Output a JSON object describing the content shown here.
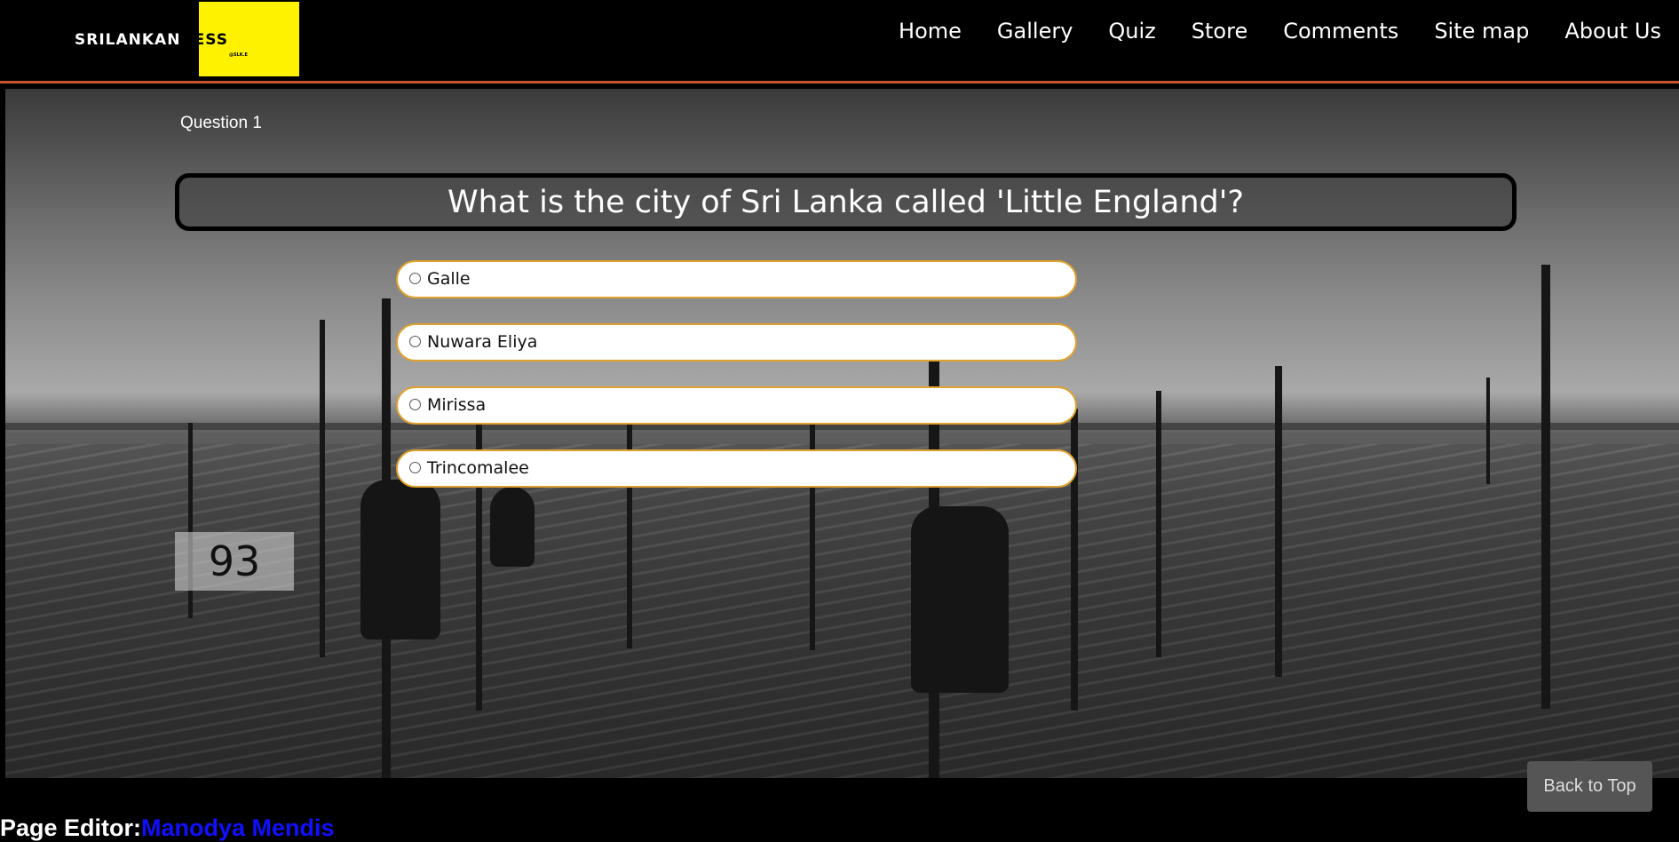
{
  "header": {
    "logo": {
      "text_light": "SRILANKAN",
      "text_dark": "NESS",
      "subtext": "@SLK.E",
      "accent_color": "#fff200"
    },
    "nav": [
      "Home",
      "Gallery",
      "Quiz",
      "Store",
      "Comments",
      "Site map",
      "About Us"
    ],
    "divider_color": "#c8552a"
  },
  "quiz": {
    "question_label": "Question 1",
    "question": "What is the city of Sri Lanka called 'Little England'?",
    "options": [
      "Galle",
      "Nuwara Eliya",
      "Mirissa",
      "Trincomalee"
    ],
    "timer": "93",
    "option_border_color": "#e0a12d"
  },
  "back_to_top": "Back to Top",
  "footer": {
    "label": "Page Editor:",
    "editor_name": "Manodya Mendis"
  }
}
